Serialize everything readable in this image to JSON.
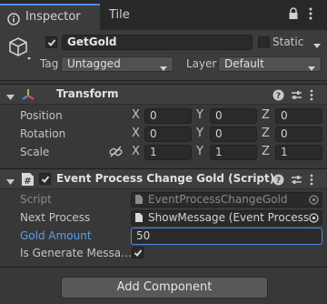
{
  "tabs": [
    {
      "label": "Inspector"
    },
    {
      "label": "Tile Palette"
    }
  ],
  "object": {
    "active": true,
    "name": "GetGold",
    "static_label": "Static",
    "static_checked": false,
    "tag_label": "Tag",
    "tag_value": "Untagged",
    "layer_label": "Layer",
    "layer_value": "Default"
  },
  "transform": {
    "title": "Transform",
    "position": {
      "label": "Position",
      "x": "0",
      "y": "0",
      "z": "0"
    },
    "rotation": {
      "label": "Rotation",
      "x": "0",
      "y": "0",
      "z": "0"
    },
    "scale": {
      "label": "Scale",
      "x": "1",
      "y": "1",
      "z": "1"
    },
    "axes": {
      "x": "X",
      "y": "Y",
      "z": "Z"
    }
  },
  "script_component": {
    "title": "Event Process Change Gold (Script)",
    "enabled": true,
    "script_label": "Script",
    "script_value": "EventProcessChangeGold",
    "next_process_label": "Next Process",
    "next_process_value": "ShowMessage (Event Process",
    "gold_amount_label": "Gold Amount",
    "gold_amount_value": "50",
    "is_generate_label": "Is Generate Messa…",
    "is_generate_checked": true
  },
  "add_component_label": "Add Component",
  "colors": {
    "accent": "#4d8ee8",
    "highlight_label": "#5b9cf0"
  }
}
